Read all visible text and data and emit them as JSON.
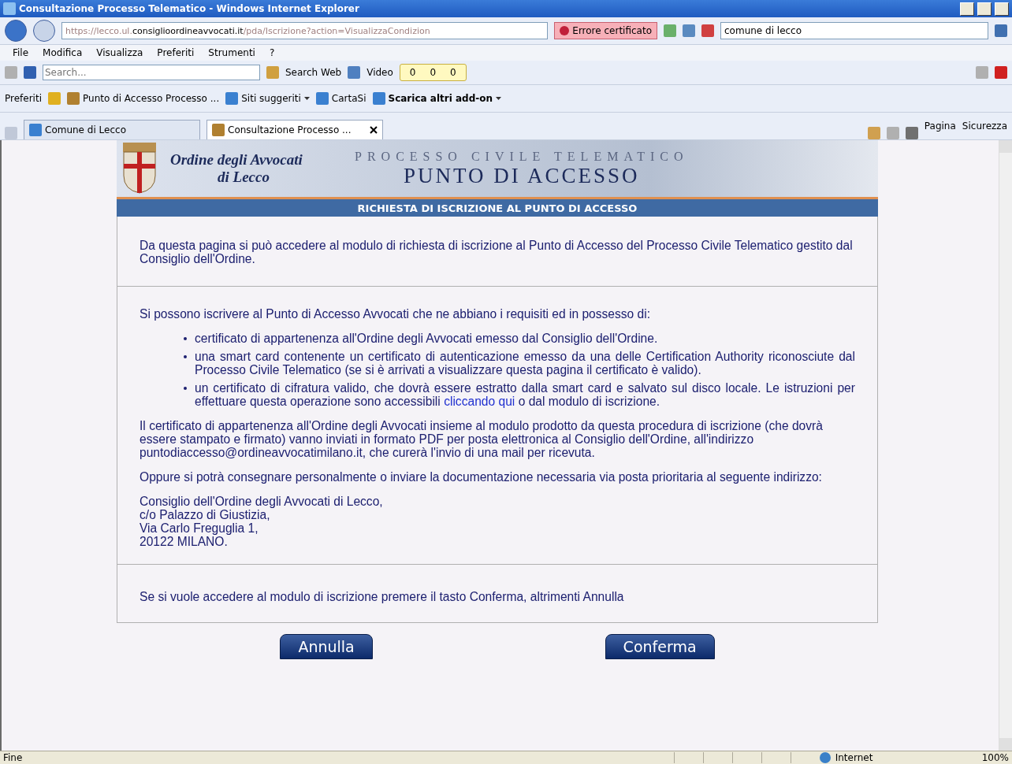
{
  "window": {
    "title": "Consultazione Processo Telematico - Windows Internet Explorer"
  },
  "address_bar": {
    "url_prefix": "https://lecco.ul.",
    "url_domain": "consiglioordineavvocati.it",
    "url_path": "/pda/Iscrizione?action=VisualizzaCondizion",
    "certificate": "Errore certificato"
  },
  "search_field": {
    "value": "comune di lecco"
  },
  "menu": [
    "File",
    "Modifica",
    "Visualizza",
    "Preferiti",
    "Strumenti",
    "?"
  ],
  "toolbar": {
    "placeholder": "Search...",
    "search_web": "Search Web",
    "video": "Video",
    "counters": [
      "0",
      "0",
      "0"
    ]
  },
  "favorites_bar": {
    "favorites": "Preferiti",
    "links": [
      {
        "kind": "site",
        "label": "Punto di Accesso Processo ...",
        "dropdown": false,
        "bold": false
      },
      {
        "kind": "ie",
        "label": "Siti suggeriti",
        "dropdown": true,
        "bold": false
      },
      {
        "kind": "ie",
        "label": "CartaSi",
        "dropdown": false,
        "bold": false
      },
      {
        "kind": "ie",
        "label": "Scarica altri add-on",
        "dropdown": true,
        "bold": true
      }
    ]
  },
  "tabs": [
    {
      "label": "Comune di Lecco",
      "kind": "ie",
      "selected": false
    },
    {
      "label": "Consultazione Processo ...",
      "kind": "site",
      "selected": true
    }
  ],
  "command_bar": [
    "Pagina",
    "Sicurezza"
  ],
  "page": {
    "org_line1": "Ordine degli Avvocati",
    "org_line2": "di Lecco",
    "header_top": "PROCESSO CIVILE TELEMATICO",
    "header_main": "PUNTO DI ACCESSO",
    "banner": "RICHIESTA DI ISCRIZIONE AL PUNTO DI ACCESSO",
    "intro": "Da questa pagina si può accedere al modulo di richiesta di iscrizione al Punto di Accesso del Processo Civile Telematico gestito dal Consiglio dell'Ordine.",
    "requirements_intro": "Si possono iscrivere al Punto di Accesso Avvocati che ne abbiano i requisiti ed in possesso di:",
    "requirements": [
      {
        "text": "certificato di appartenenza all'Ordine degli Avvocati emesso dal Consiglio dell'Ordine."
      },
      {
        "text": "una smart card contenente un certificato di autenticazione emesso da una delle Certification Authority riconosciute dal Processo Civile Telematico (se si è arrivati a visualizzare questa pagina il certificato è valido)."
      },
      {
        "text": "un certificato di cifratura valido, che dovrà essere estratto dalla smart card e salvato sul disco locale. Le istruzioni per effettuare questa operazione sono accessibili",
        "link": "cliccando qui",
        "after": "o dal modulo di iscrizione."
      }
    ],
    "paragraphs": [
      "Il certificato di appartenenza all'Ordine degli Avvocati insieme al modulo prodotto da questa procedura di iscrizione (che dovrà essere stampato e firmato) vanno inviati in formato PDF per posta elettronica al Consiglio dell'Ordine, all'indirizzo puntodiaccesso@ordineavvocatimilano.it, che curerà l'invio di una mail per ricevuta.",
      "Oppure si potrà consegnare personalmente o inviare la documentazione necessaria via posta prioritaria al seguente indirizzo:"
    ],
    "address": [
      "Consiglio dell'Ordine degli Avvocati di Lecco,",
      "c/o Palazzo di Giustizia,",
      "Via Carlo Freguglia 1,",
      "20122 MILANO."
    ],
    "confirm_text": "Se si vuole accedere al modulo di iscrizione premere il tasto Conferma, altrimenti Annulla",
    "buttons": [
      "Annulla",
      "Conferma"
    ]
  },
  "status_bar": {
    "text": "Fine",
    "zone": "Internet",
    "zoom": "100%"
  }
}
